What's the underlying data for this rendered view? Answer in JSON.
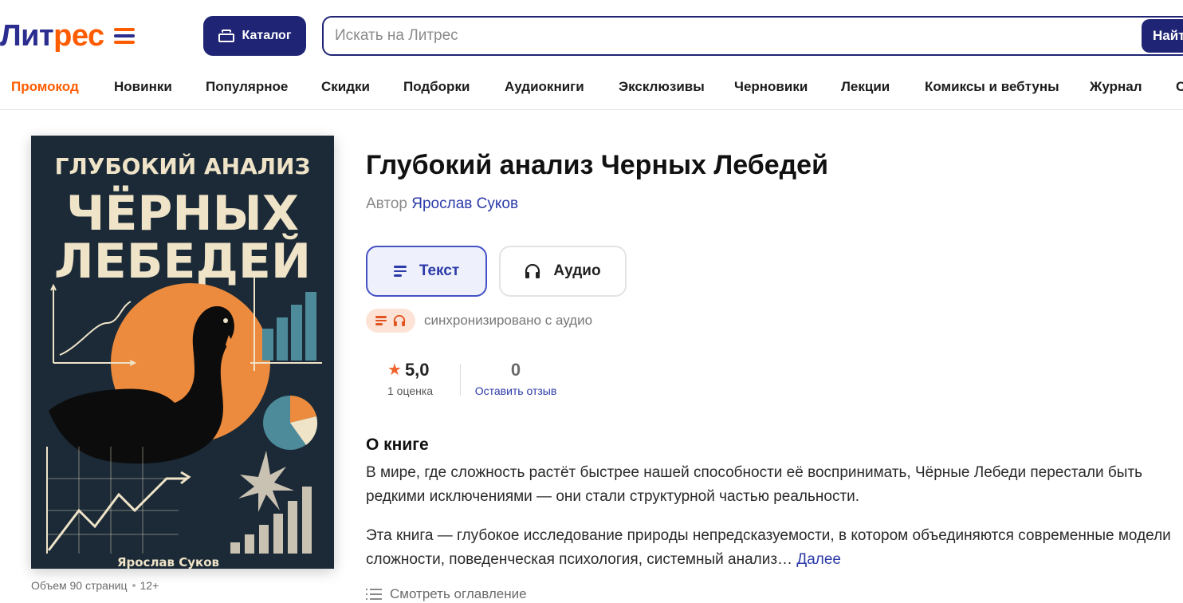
{
  "header": {
    "logo": {
      "part1": "Лит",
      "part2": "рес"
    },
    "catalog_label": "Каталог",
    "search_placeholder": "Искать на Литрес",
    "search_button": "Найт"
  },
  "nav": [
    "Промокод",
    "Новинки",
    "Популярное",
    "Скидки",
    "Подборки",
    "Аудиокниги",
    "Эксклюзивы",
    "Черновики",
    "Лекции",
    "Комиксы и вебтуны",
    "Журнал",
    "С"
  ],
  "book": {
    "title": "Глубокий анализ Черных Лебедей",
    "author_prefix": "Автор",
    "author": "Ярослав Суков",
    "format_text": "Текст",
    "format_audio": "Аудио",
    "sync_text": "синхронизировано с аудио",
    "rating": "5,0",
    "rating_count": "1 оценка",
    "reviews": "0",
    "review_link": "Оставить отзыв",
    "about_heading": "О книге",
    "paragraph1": "В мире, где сложность растёт быстрее нашей способности её воспринимать, Чёрные Лебеди перестали быть редкими исключениями — они стали структурной частью реальности.",
    "paragraph2": "Эта книга — глубокое исследование природы непредсказуемости, в котором объединяются современные модели сложности, поведенческая психология, системный анализ…",
    "more_link": "Далее",
    "toc_link": "Смотреть оглавление",
    "volume": "Объем 90 страниц",
    "age": "12+"
  },
  "cover": {
    "line1": "ГЛУБОКИЙ АНАЛИЗ",
    "line2": "ЧЁРНЫХ",
    "line3": "ЛЕБЕДЕЙ",
    "author": "Ярослав Суков"
  },
  "colors": {
    "brand_blue": "#1f2475",
    "brand_orange": "#ff5c00",
    "link": "#2b3aa8",
    "cover_bg": "#1b2a36",
    "cover_orange": "#ec8a3d",
    "cover_teal": "#4d8a9a"
  }
}
